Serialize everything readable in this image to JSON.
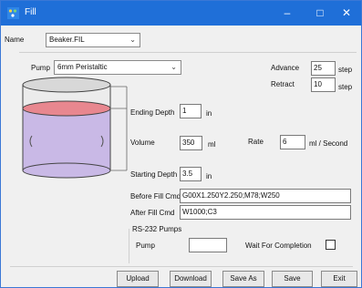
{
  "window": {
    "title": "Fill",
    "minimize": "–",
    "maximize": "□",
    "close": "✕"
  },
  "form": {
    "name_label": "Name",
    "name_value": "Beaker.FIL",
    "pump_label": "Pump",
    "pump_value": "6mm Peristaltic",
    "advance_label": "Advance",
    "advance_value": "25",
    "advance_unit": "step",
    "retract_label": "Retract",
    "retract_value": "10",
    "retract_unit": "step",
    "ending_depth_label": "Ending Depth",
    "ending_depth_value": "1",
    "ending_depth_unit": "in",
    "volume_label": "Volume",
    "volume_value": "350",
    "volume_unit": "ml",
    "rate_label": "Rate",
    "rate_value": "6",
    "rate_unit": "ml / Second",
    "starting_depth_label": "Starting Depth",
    "starting_depth_value": "3.5",
    "starting_depth_unit": "in",
    "before_fill_label": "Before Fill Cmd",
    "before_fill_value": "G00X1.250Y2.250;M78;W250",
    "after_fill_label": "After Fill Cmd",
    "after_fill_value": "W1000;C3",
    "rs232_label": "RS-232 Pumps",
    "rs_pump_label": "Pump",
    "rs_pump_value": "",
    "wait_label": "Wait For Completion",
    "wait_checked": false
  },
  "buttons": {
    "upload": "Upload",
    "download": "Download",
    "save_as": "Save As",
    "save": "Save",
    "exit": "Exit"
  },
  "colors": {
    "titlebar": "#1f6fd8",
    "liquid_top": "#e8878f",
    "liquid_body": "#c9b9e6"
  }
}
